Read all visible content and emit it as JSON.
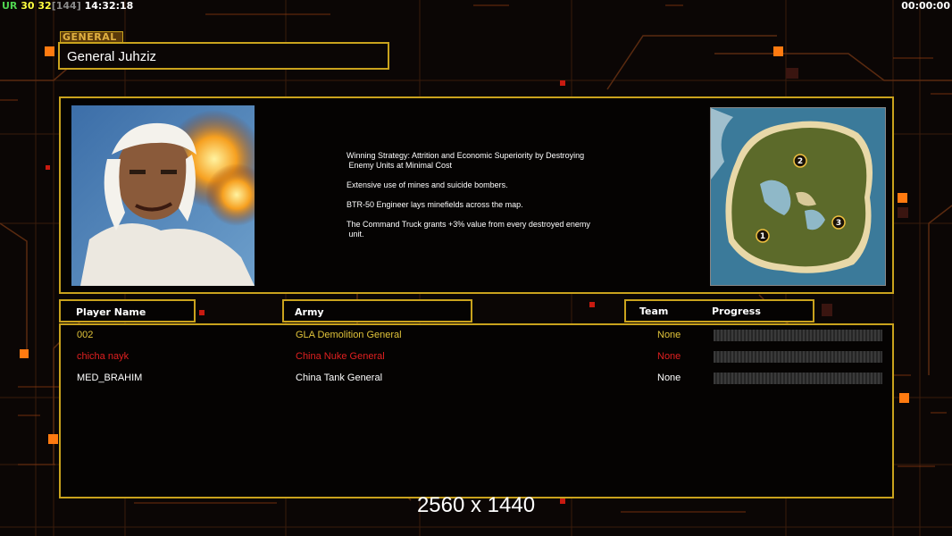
{
  "hud": {
    "ur_label": "UR",
    "fps_a": "30",
    "fps_b": "32",
    "bracket": "[144]",
    "clock": "14:32:18",
    "timer": "00:00:00"
  },
  "general": {
    "section_label": "GENERAL",
    "name": "General Juhziz"
  },
  "description": {
    "lines": [
      "Winning Strategy: Attrition and Economic Superiority by Destroying",
      " Enemy Units at Minimal Cost",
      "Extensive use of mines and suicide bombers.",
      "BTR-50 Engineer lays minefields across the map.",
      "The Command Truck grants +3% value from every destroyed enemy",
      " unit."
    ]
  },
  "map": {
    "spawn_1": "1",
    "spawn_2": "2",
    "spawn_3": "3"
  },
  "table": {
    "headers": {
      "player_name": "Player Name",
      "army": "Army",
      "team": "Team",
      "progress": "Progress"
    },
    "rows": [
      {
        "player": "002",
        "army": "GLA Demolition General",
        "team": "None",
        "color": "#e0c33a"
      },
      {
        "player": "chicha nayk",
        "army": "China Nuke General",
        "team": "None",
        "color": "#e02020"
      },
      {
        "player": "MED_BRAHIM",
        "army": "China Tank General",
        "team": "None",
        "color": "#ffffff"
      }
    ]
  },
  "resolution": "2560 x 1440",
  "colors": {
    "frame": "#c9a21d",
    "accent": "#ff7a10"
  }
}
